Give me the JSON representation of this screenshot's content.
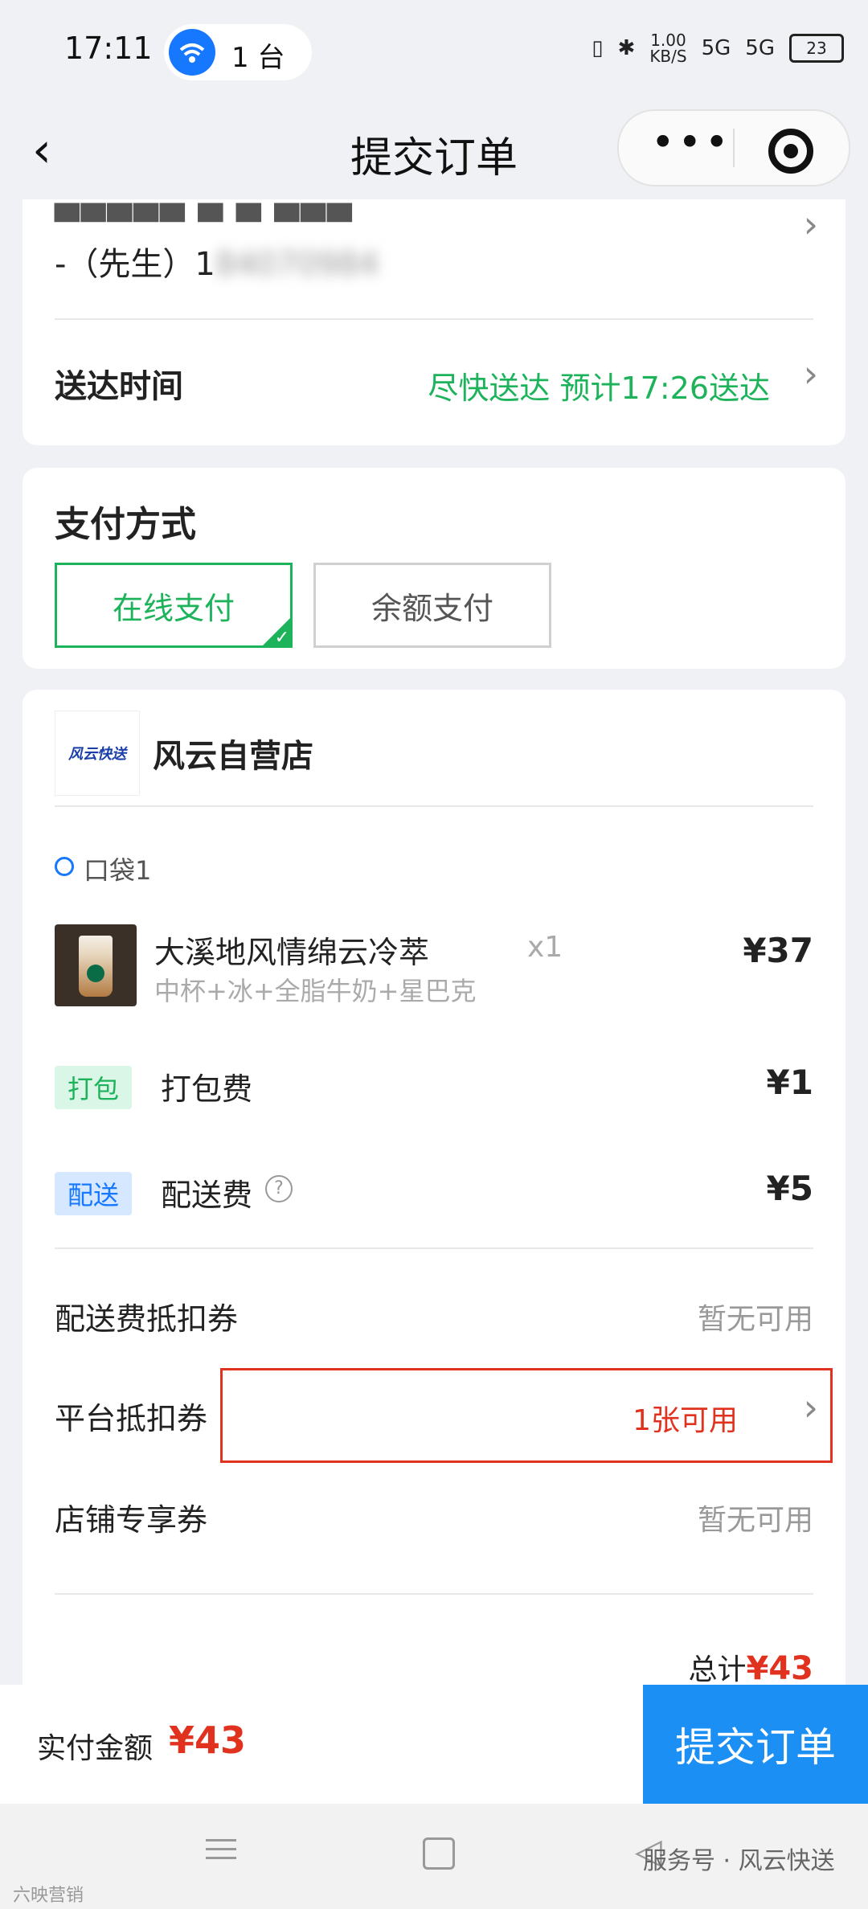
{
  "status": {
    "time": "17:11",
    "devices": "1 台",
    "speed": "1.00\nKB/S",
    "net1": "5G",
    "net2": "5G",
    "battery": "23"
  },
  "nav": {
    "back": "‹",
    "title": "提交订单"
  },
  "address": {
    "contact": "-（先生）1",
    "phone_blur": "84070984"
  },
  "delivery": {
    "label": "送达时间",
    "value": "尽快送达 预计17:26送达"
  },
  "payment": {
    "title": "支付方式",
    "options": [
      "在线支付",
      "余额支付"
    ]
  },
  "shop": {
    "name": "风云自营店",
    "logo_text": "风云快送"
  },
  "bag": {
    "label": "口袋1"
  },
  "product": {
    "name": "大溪地风情绵云冷萃",
    "spec": "中杯+冰+全脂牛奶+星巴克",
    "qty": "x1",
    "price": "¥37"
  },
  "fees": [
    {
      "tag": "打包",
      "label": "打包费",
      "price": "¥1",
      "color": "#1db35a",
      "bg": "#d9f6e6"
    },
    {
      "tag": "配送",
      "label": "配送费",
      "price": "¥5",
      "color": "#1677ff",
      "bg": "#d6e8ff"
    }
  ],
  "coupons": [
    {
      "label": "配送费抵扣券",
      "value": "暂无可用"
    },
    {
      "label": "平台抵扣券",
      "value": "1张可用"
    },
    {
      "label": "店铺专享券",
      "value": "暂无可用"
    }
  ],
  "total": {
    "label": "总计",
    "value": "¥43"
  },
  "footer": {
    "paid_label": "实付金额",
    "paid_value": "¥43",
    "submit": "提交订单"
  },
  "watermark": {
    "left": "六映营销",
    "right": "服务号 · 风云快送"
  },
  "colors": {
    "accent": "#1db35a",
    "primary": "#1c8ff5",
    "red": "#e0321e"
  }
}
